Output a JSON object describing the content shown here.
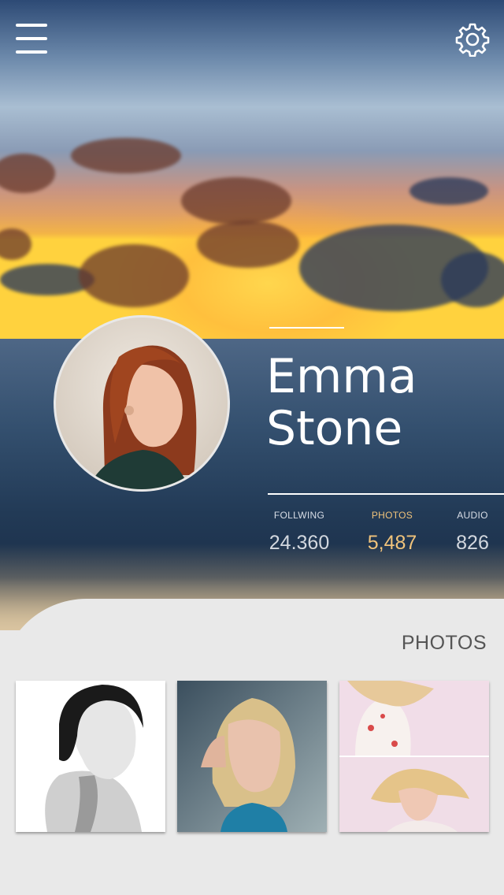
{
  "header": {
    "menu_icon": "hamburger-menu-icon",
    "settings_icon": "gear-icon"
  },
  "profile": {
    "first_name": "Emma",
    "last_name": "Stone",
    "stats": [
      {
        "label": "FOLLWING",
        "value": "24.360"
      },
      {
        "label": "PHOTOS",
        "value": "5,487"
      },
      {
        "label": "AUDIO",
        "value": "826"
      }
    ]
  },
  "photos_section": {
    "title": "PHOTOS"
  },
  "colors": {
    "accent": "#f0c37b",
    "panel": "#e9e9e9",
    "white": "#ffffff"
  }
}
